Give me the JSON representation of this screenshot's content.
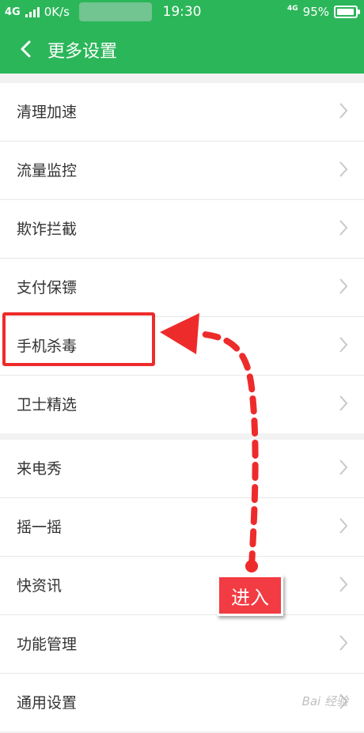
{
  "status_bar": {
    "network": "4G",
    "speed": "0K/s",
    "time": "19:30",
    "network_small": "4G",
    "battery": "95%",
    "battery_level": 0.95
  },
  "header": {
    "title": "更多设置"
  },
  "groups": [
    {
      "items": [
        {
          "label": "清理加速"
        },
        {
          "label": "流量监控"
        },
        {
          "label": "欺诈拦截"
        },
        {
          "label": "支付保镖"
        },
        {
          "label": "手机杀毒"
        },
        {
          "label": "卫士精选"
        }
      ]
    },
    {
      "items": [
        {
          "label": "来电秀"
        },
        {
          "label": "摇一摇"
        },
        {
          "label": "快资讯"
        },
        {
          "label": "功能管理"
        },
        {
          "label": "通用设置"
        }
      ]
    }
  ],
  "annotation": {
    "callout_text": "进入"
  },
  "watermark": "Bai 经验",
  "colors": {
    "brand_green": "#2cb65a",
    "annotation_red": "#ee2b2b"
  }
}
